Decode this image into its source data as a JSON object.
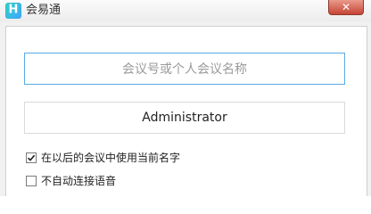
{
  "window": {
    "title": "会易通",
    "logo_glyph": "H",
    "close_symbol": "✕",
    "accent_color": "#3ea7ff",
    "close_color": "#c74536"
  },
  "form": {
    "meeting_placeholder": "会议号或个人会议名称",
    "meeting_value": "",
    "name_value": "Administrator",
    "options": [
      {
        "label": "在以后的会议中使用当前名字",
        "checked": true
      },
      {
        "label": "不自动连接语音",
        "checked": false
      }
    ]
  }
}
